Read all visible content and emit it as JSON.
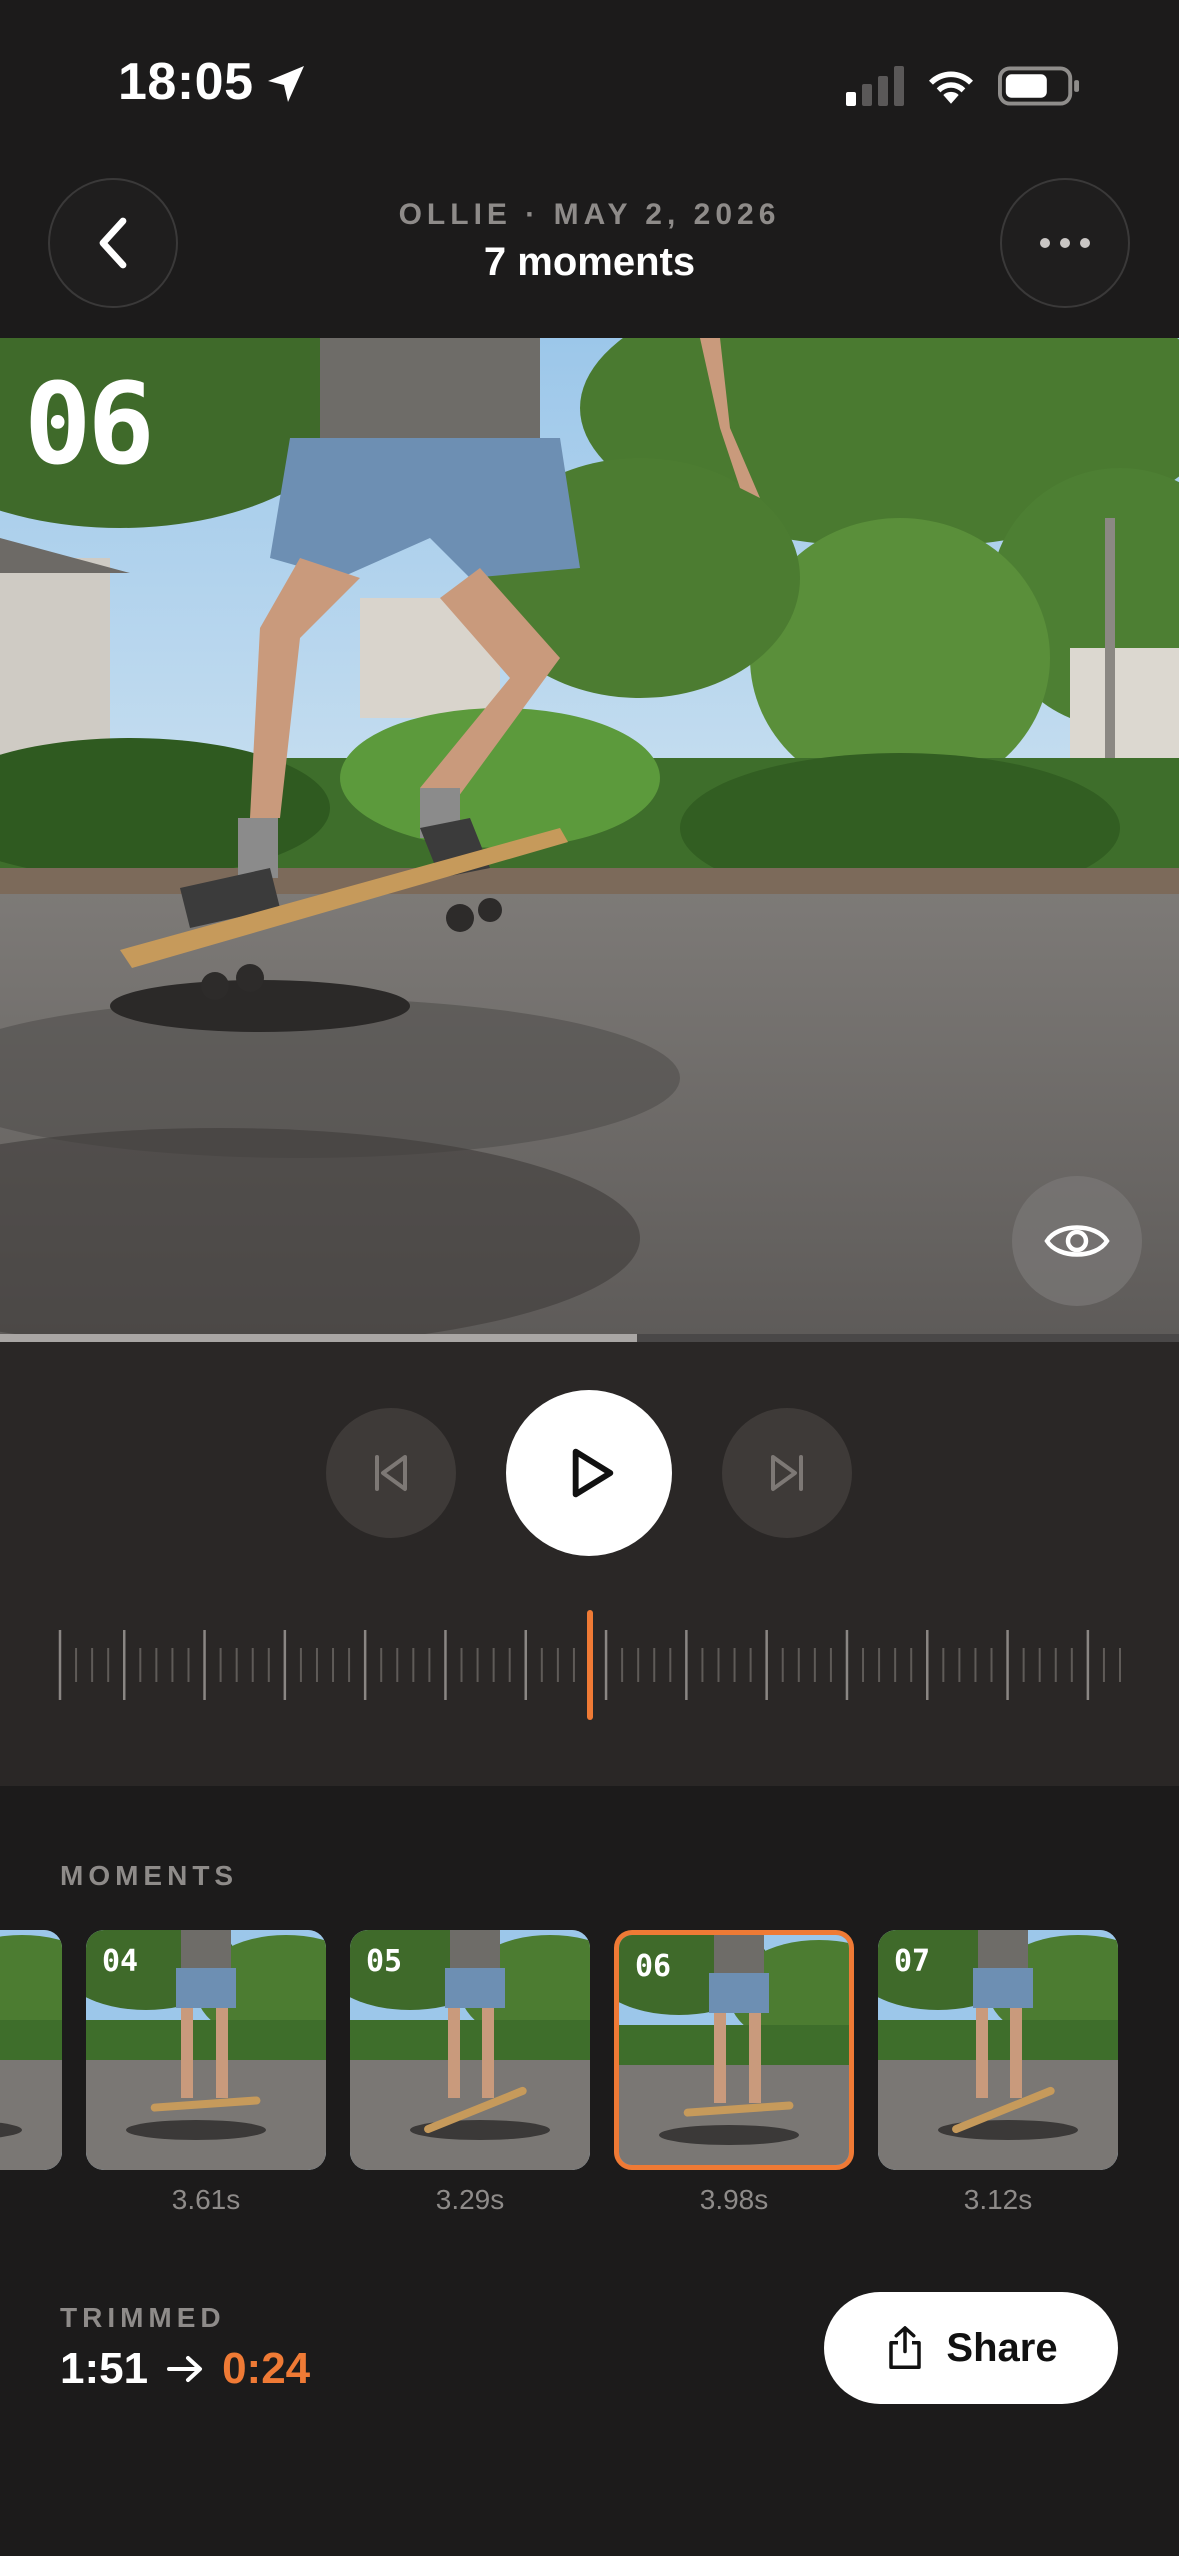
{
  "status_bar": {
    "time": "18:05",
    "icons": [
      "location-arrow-icon",
      "cellular-signal-icon",
      "wifi-icon",
      "battery-icon"
    ]
  },
  "header": {
    "subtitle": "OLLIE · MAY 2, 2026",
    "title": "7 moments",
    "back_icon": "chevron-left-icon",
    "more_icon": "ellipsis-icon"
  },
  "player": {
    "current_moment": "06",
    "progress_fraction": 0.54,
    "visibility_icon": "eye-icon",
    "controls": [
      "previous-icon",
      "play-icon",
      "next-icon"
    ]
  },
  "moments": {
    "label": "MOMENTS",
    "items": [
      {
        "number": "",
        "duration": ""
      },
      {
        "number": "04",
        "duration": "3.61s"
      },
      {
        "number": "05",
        "duration": "3.29s"
      },
      {
        "number": "06",
        "duration": "3.98s",
        "active": true
      },
      {
        "number": "07",
        "duration": "3.12s"
      }
    ]
  },
  "footer": {
    "trim_label": "TRIMMED",
    "from": "1:51",
    "to": "0:24",
    "share_label": "Share"
  },
  "colors": {
    "accent": "#ef7a35",
    "background": "#1c1b1b",
    "panel": "#2a2726"
  }
}
